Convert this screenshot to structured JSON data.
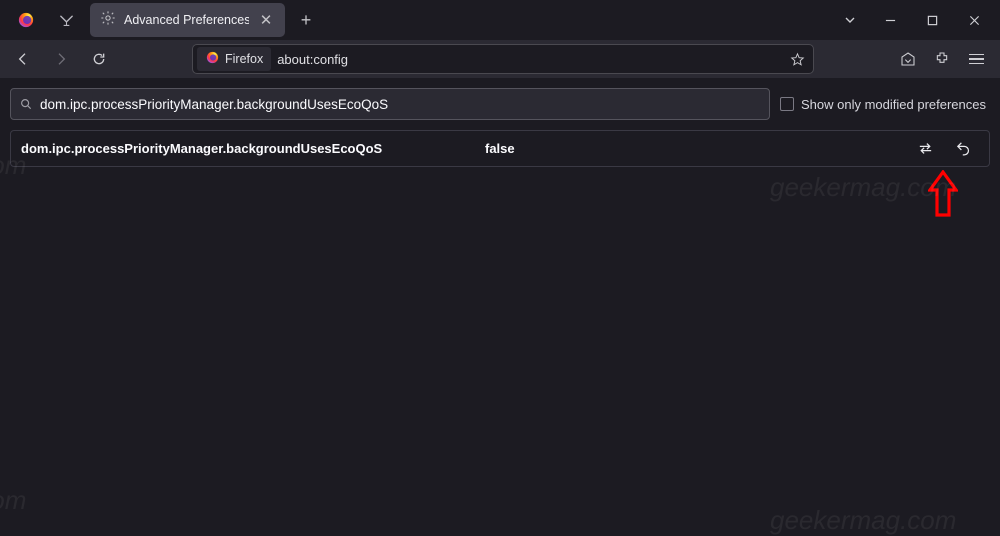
{
  "tab": {
    "title": "Advanced Preferences"
  },
  "urlbar": {
    "identity_label": "Firefox",
    "url": "about:config"
  },
  "search": {
    "value": "dom.ipc.processPriorityManager.backgroundUsesEcoQoS"
  },
  "show_modified_label": "Show only modified preferences",
  "prefs": [
    {
      "name": "dom.ipc.processPriorityManager.backgroundUsesEcoQoS",
      "value": "false"
    }
  ],
  "watermark_text": "geekermag.com"
}
